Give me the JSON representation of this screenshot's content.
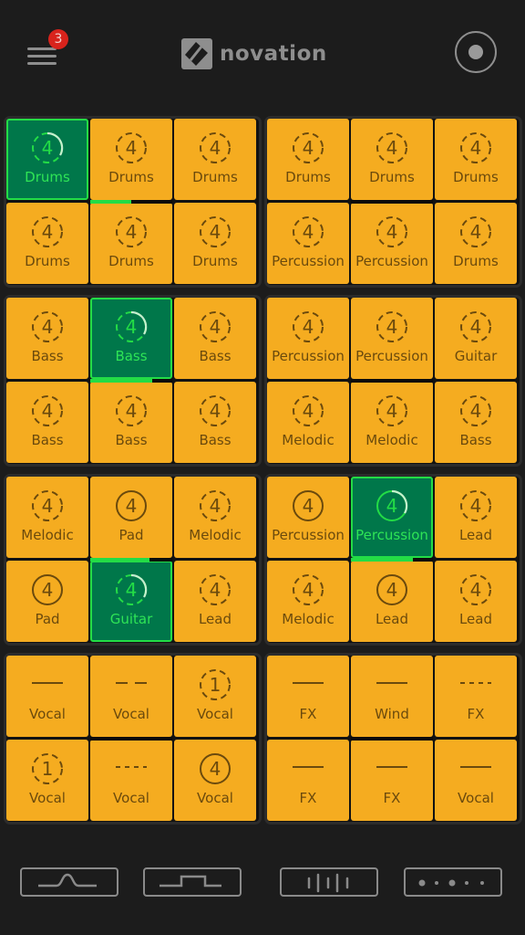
{
  "header": {
    "menu_icon": "hamburger-menu-icon",
    "notification_count": "3",
    "brand": "novation",
    "record_icon": "record-icon"
  },
  "colors": {
    "background": "#1c1c1c",
    "pad_idle": "#f5ac20",
    "pad_active": "#00774a",
    "active_accent": "#23dc46",
    "idle_text": "#6b4a0d",
    "badge": "#d8231c"
  },
  "groups": [
    {
      "name": "group-1",
      "progress": 0.5,
      "pads": [
        {
          "label": "Drums",
          "type": "ring",
          "value": "4",
          "style": "dashed",
          "active": true
        },
        {
          "label": "Drums",
          "type": "ring",
          "value": "4",
          "style": "dashed",
          "active": false
        },
        {
          "label": "Drums",
          "type": "ring",
          "value": "4",
          "style": "dashed",
          "active": false
        },
        {
          "label": "Drums",
          "type": "ring",
          "value": "4",
          "style": "dashed",
          "active": false
        },
        {
          "label": "Drums",
          "type": "ring",
          "value": "4",
          "style": "dashed",
          "active": false
        },
        {
          "label": "Drums",
          "type": "ring",
          "value": "4",
          "style": "dashed",
          "active": false
        }
      ]
    },
    {
      "name": "group-2",
      "progress": 0,
      "pads": [
        {
          "label": "Drums",
          "type": "ring",
          "value": "4",
          "style": "dashed",
          "active": false
        },
        {
          "label": "Drums",
          "type": "ring",
          "value": "4",
          "style": "dashed",
          "active": false
        },
        {
          "label": "Drums",
          "type": "ring",
          "value": "4",
          "style": "dashed",
          "active": false
        },
        {
          "label": "Percussion",
          "type": "ring",
          "value": "4",
          "style": "dashed",
          "active": false
        },
        {
          "label": "Percussion",
          "type": "ring",
          "value": "4",
          "style": "dashed",
          "active": false
        },
        {
          "label": "Drums",
          "type": "ring",
          "value": "4",
          "style": "dashed",
          "active": false
        }
      ]
    },
    {
      "name": "group-3",
      "progress": 0.75,
      "pads": [
        {
          "label": "Bass",
          "type": "ring",
          "value": "4",
          "style": "dashed",
          "active": false
        },
        {
          "label": "Bass",
          "type": "ring",
          "value": "4",
          "style": "dashed",
          "active": true
        },
        {
          "label": "Bass",
          "type": "ring",
          "value": "4",
          "style": "dashed",
          "active": false
        },
        {
          "label": "Bass",
          "type": "ring",
          "value": "4",
          "style": "dashed",
          "active": false
        },
        {
          "label": "Bass",
          "type": "ring",
          "value": "4",
          "style": "dashed",
          "active": false
        },
        {
          "label": "Bass",
          "type": "ring",
          "value": "4",
          "style": "dashed",
          "active": false
        }
      ]
    },
    {
      "name": "group-4",
      "progress": 0,
      "pads": [
        {
          "label": "Percussion",
          "type": "ring",
          "value": "4",
          "style": "dashed",
          "active": false
        },
        {
          "label": "Percussion",
          "type": "ring",
          "value": "4",
          "style": "dashed",
          "active": false
        },
        {
          "label": "Guitar",
          "type": "ring",
          "value": "4",
          "style": "dashed",
          "active": false
        },
        {
          "label": "Melodic",
          "type": "ring",
          "value": "4",
          "style": "dashed",
          "active": false
        },
        {
          "label": "Melodic",
          "type": "ring",
          "value": "4",
          "style": "dashed",
          "active": false
        },
        {
          "label": "Bass",
          "type": "ring",
          "value": "4",
          "style": "dashed",
          "active": false
        }
      ]
    },
    {
      "name": "group-5",
      "progress": 0.72,
      "pads": [
        {
          "label": "Melodic",
          "type": "ring",
          "value": "4",
          "style": "dashed",
          "active": false
        },
        {
          "label": "Pad",
          "type": "ring",
          "value": "4",
          "style": "solid",
          "active": false
        },
        {
          "label": "Melodic",
          "type": "ring",
          "value": "4",
          "style": "dashed",
          "active": false
        },
        {
          "label": "Pad",
          "type": "ring",
          "value": "4",
          "style": "solid",
          "active": false
        },
        {
          "label": "Guitar",
          "type": "ring",
          "value": "4",
          "style": "dashed",
          "active": true
        },
        {
          "label": "Lead",
          "type": "ring",
          "value": "4",
          "style": "dashed",
          "active": false
        }
      ]
    },
    {
      "name": "group-6",
      "progress": 0.75,
      "pads": [
        {
          "label": "Percussion",
          "type": "ring",
          "value": "4",
          "style": "solid",
          "active": false
        },
        {
          "label": "Percussion",
          "type": "ring",
          "value": "4",
          "style": "solid",
          "active": true
        },
        {
          "label": "Lead",
          "type": "ring",
          "value": "4",
          "style": "dashed",
          "active": false
        },
        {
          "label": "Melodic",
          "type": "ring",
          "value": "4",
          "style": "dashed",
          "active": false
        },
        {
          "label": "Lead",
          "type": "ring",
          "value": "4",
          "style": "solid",
          "active": false
        },
        {
          "label": "Lead",
          "type": "ring",
          "value": "4",
          "style": "dashed",
          "active": false
        }
      ]
    },
    {
      "name": "group-7",
      "progress": 0,
      "pads": [
        {
          "label": "Vocal",
          "type": "line",
          "style": "solid",
          "active": false
        },
        {
          "label": "Vocal",
          "type": "line",
          "style": "dash2",
          "active": false
        },
        {
          "label": "Vocal",
          "type": "ring",
          "value": "1",
          "style": "dashed",
          "active": false
        },
        {
          "label": "Vocal",
          "type": "ring",
          "value": "1",
          "style": "dashed",
          "active": false
        },
        {
          "label": "Vocal",
          "type": "line",
          "style": "dash4",
          "active": false
        },
        {
          "label": "Vocal",
          "type": "ring",
          "value": "4",
          "style": "solid",
          "active": false
        }
      ]
    },
    {
      "name": "group-8",
      "progress": 0,
      "pads": [
        {
          "label": "FX",
          "type": "line",
          "style": "solid",
          "active": false
        },
        {
          "label": "Wind",
          "type": "line",
          "style": "solid",
          "active": false
        },
        {
          "label": "FX",
          "type": "line",
          "style": "dash4",
          "active": false
        },
        {
          "label": "FX",
          "type": "line",
          "style": "solid",
          "active": false
        },
        {
          "label": "FX",
          "type": "line",
          "style": "solid",
          "active": false
        },
        {
          "label": "Vocal",
          "type": "line",
          "style": "solid",
          "active": false
        }
      ]
    }
  ],
  "footer": {
    "buttons": [
      {
        "name": "filter-bump-button",
        "icon": "bump-filter-icon"
      },
      {
        "name": "gate-button",
        "icon": "square-gate-icon"
      },
      {
        "name": "beat-repeat-button",
        "icon": "stutter-lines-icon"
      },
      {
        "name": "delay-button",
        "icon": "dots-delay-icon"
      }
    ]
  }
}
